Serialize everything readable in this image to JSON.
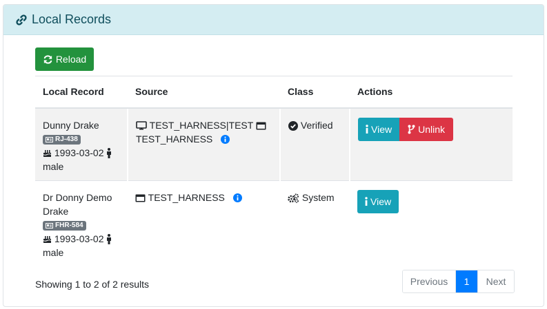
{
  "header": {
    "title": "Local Records"
  },
  "toolbar": {
    "reload_label": "Reload"
  },
  "table": {
    "columns": [
      "Local Record",
      "Source",
      "Class",
      "Actions"
    ],
    "rows": [
      {
        "name": "Dunny Drake",
        "badge": "RJ-438",
        "dob": "1993-03-02",
        "gender": "male",
        "source_line1": "TEST_HARNESS|TEST",
        "source_line2": "TEST_HARNESS",
        "class": "Verified",
        "view_label": "View",
        "unlink_label": "Unlink"
      },
      {
        "name": "Dr Donny Demo Drake",
        "badge": "FHR-584",
        "dob": "1993-03-02",
        "gender": "male",
        "source_line1": "TEST_HARNESS",
        "class": "System",
        "view_label": "View"
      }
    ]
  },
  "footer": {
    "summary": "Showing 1 to 2 of 2 results"
  },
  "pagination": {
    "previous": "Previous",
    "current": "1",
    "next": "Next"
  },
  "colors": {
    "header_bg": "#d4edf2",
    "success": "#23923d",
    "info": "#17a2b8",
    "danger": "#dc3545",
    "primary": "#007bff",
    "badge": "#6c757d"
  }
}
